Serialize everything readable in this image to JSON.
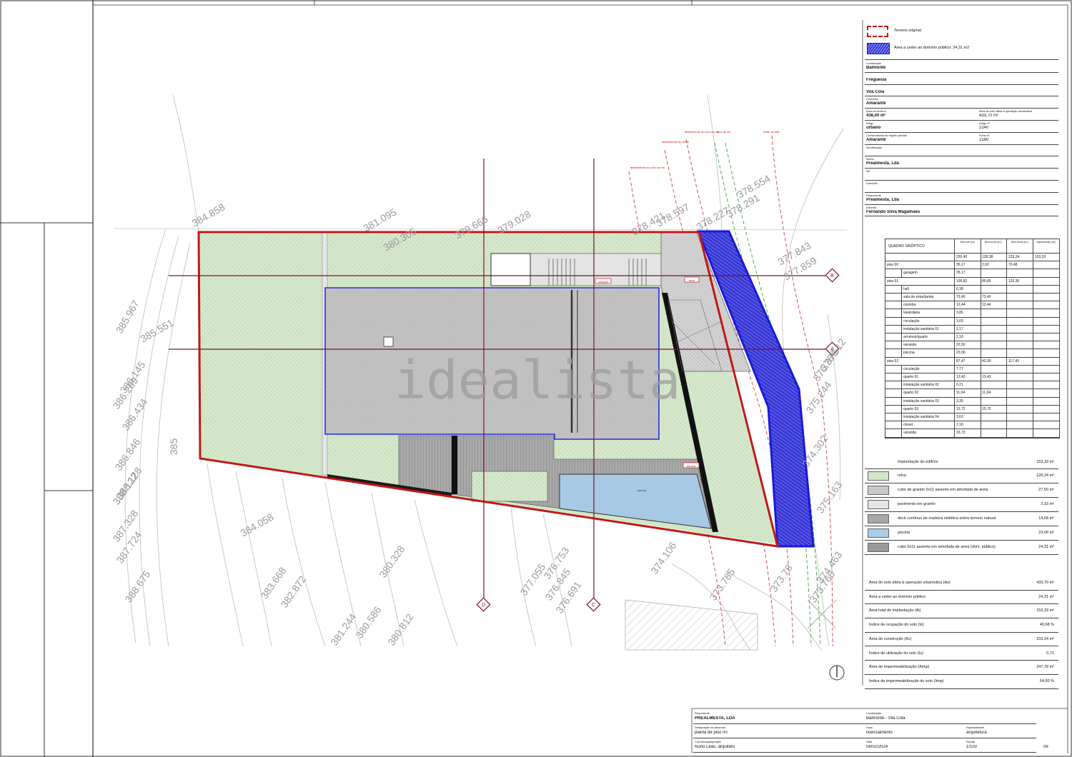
{
  "watermark": "idealista",
  "legend_top": [
    {
      "label": "Terreno original",
      "swatch": "red-dashed"
    },
    {
      "label": "Área a ceder ao domínio público: 24,31 m2",
      "swatch": "blue-hatch"
    }
  ],
  "info": {
    "rows": [
      {
        "h": "Localização",
        "v": "Balmonte"
      },
      {
        "h": "",
        "v": "Freguesia"
      },
      {
        "h": "",
        "v": "Vila Cola"
      },
      {
        "h": "Concelho",
        "v": "Amarante"
      },
      {
        "h": "Área do terreno",
        "v": "438,00 m²",
        "h2": "Área do solo afeta à operação urbanística",
        "v2": "433,70 m²"
      },
      {
        "h": "Artigo",
        "v": "urbano",
        "h2": "Artigo nº",
        "v2": "2140"
      },
      {
        "h": "Conservatória do registo predial",
        "v": "Amarante",
        "h2": "Ficha nº",
        "v2": "2180"
      },
      {
        "h": "Identificação",
        "v": ""
      },
      {
        "h": "Nome",
        "v": "Prealmesta, Lda"
      },
      {
        "h": "Nif",
        "v": ""
      },
      {
        "h": "Domicílio",
        "v": ""
      },
      {
        "h": "Requerente",
        "v": "Prealmesta, Lda"
      },
      {
        "h": "Gerente",
        "v": "Fernando Silva Magalhães"
      }
    ]
  },
  "synoptic": {
    "title": "QUADRO SINÓPTICO",
    "col_headers": [
      "Área útil (m²)",
      "Área bruta (m²)",
      "Área bruta (m²)",
      "Implantação (m²)"
    ],
    "rows": [
      {
        "name": "",
        "indent": false,
        "v": [
          "230,40",
          "128,38",
          "233,24",
          "153,33"
        ]
      },
      {
        "name": "piso 00",
        "indent": false,
        "v": [
          "35,17",
          "2,00",
          "70,48",
          ""
        ]
      },
      {
        "name": "garagem",
        "indent": true,
        "v": [
          "35,17",
          "",
          "",
          ""
        ]
      },
      {
        "name": "piso 01",
        "indent": false,
        "v": [
          "100,82",
          "85,85",
          "133,30",
          ""
        ]
      },
      {
        "name": "hall",
        "indent": true,
        "v": [
          "6,38",
          "",
          "",
          ""
        ]
      },
      {
        "name": "sala de estar/jantar",
        "indent": true,
        "v": [
          "73,40",
          "73,40",
          "",
          ""
        ]
      },
      {
        "name": "cozinha",
        "indent": true,
        "v": [
          "12,44",
          "12,44",
          "",
          ""
        ]
      },
      {
        "name": "lavandaria",
        "indent": true,
        "v": [
          "3,86",
          "",
          "",
          ""
        ]
      },
      {
        "name": "circulação",
        "indent": true,
        "v": [
          "3,03",
          "",
          "",
          ""
        ]
      },
      {
        "name": "instalação sanitária 01",
        "indent": true,
        "v": [
          "2,17",
          "",
          "",
          ""
        ]
      },
      {
        "name": "arrumos/quarto",
        "indent": true,
        "v": [
          "2,18",
          "",
          "",
          ""
        ]
      },
      {
        "name": "varanda",
        "indent": true,
        "v": [
          "22,50",
          "",
          "",
          ""
        ]
      },
      {
        "name": "piscina",
        "indent": true,
        "v": [
          "23,06",
          "",
          "",
          ""
        ]
      },
      {
        "name": "piso 02",
        "indent": false,
        "v": [
          "87,47",
          "42,00",
          "117,43",
          ""
        ]
      },
      {
        "name": "circulação",
        "indent": true,
        "v": [
          "7,77",
          "",
          "",
          ""
        ]
      },
      {
        "name": "quarto 01",
        "indent": true,
        "v": [
          "13,43",
          "13,43",
          "",
          ""
        ]
      },
      {
        "name": "instalação sanitária 02",
        "indent": true,
        "v": [
          "6,21",
          "",
          "",
          ""
        ]
      },
      {
        "name": "quarto 02",
        "indent": true,
        "v": [
          "11,04",
          "11,04",
          "",
          ""
        ]
      },
      {
        "name": "instalação sanitária 03",
        "indent": true,
        "v": [
          "3,30",
          "",
          "",
          ""
        ]
      },
      {
        "name": "quarto 03",
        "indent": true,
        "v": [
          "15,72",
          "15,72",
          "",
          ""
        ]
      },
      {
        "name": "instalação sanitária 04",
        "indent": true,
        "v": [
          "3,63",
          "",
          "",
          ""
        ]
      },
      {
        "name": "closet",
        "indent": true,
        "v": [
          "2,18",
          "",
          "",
          ""
        ]
      },
      {
        "name": "varanda",
        "indent": true,
        "v": [
          "33,73",
          "",
          "",
          ""
        ]
      }
    ]
  },
  "materials": {
    "header": {
      "label": "Implantação do edifício",
      "value": "153,33 m²"
    },
    "items": [
      {
        "label": "relva",
        "value": "128,24 m²",
        "swatch": "#d3e6c9"
      },
      {
        "label": "cubo de granito 5x11 assente em almofada de areia",
        "value": "27,50 m²",
        "swatch": "#c9c9c9"
      },
      {
        "label": "pavimento em granito",
        "value": "2,33 m²",
        "swatch": "#e4e4e4"
      },
      {
        "label": "deck contínuo de madeira sintética sobre terreno natural",
        "value": "14,68 m²",
        "swatch": "#a8a8a8"
      },
      {
        "label": "piscina",
        "value": "23,06 m²",
        "swatch": "#a9cbe6"
      },
      {
        "label": "cubo 5x11 assente em almofada de areia (dom. público)",
        "value": "24,31 m²",
        "swatch": "#9a9a9a"
      }
    ]
  },
  "indices": [
    {
      "label": "Área do solo afeta à operação urbanística (As)",
      "value": "433,70 m²"
    },
    {
      "label": "Área a ceder ao domínio público",
      "value": "24,31 m²"
    },
    {
      "label": "Área total de implantação (Ai)",
      "value": "153,33 m²"
    },
    {
      "label": "Índice de ocupação do solo (Io)",
      "value": "40,68 %"
    },
    {
      "label": "Área de construção (Ac)",
      "value": "233,24 m²"
    },
    {
      "label": "Índice de utilização do solo (Iu)",
      "value": "0,71"
    },
    {
      "label": "Área de impermeabilização (Aimp)",
      "value": "247,78 m²"
    },
    {
      "label": "Índice de impermeabilização do solo (Iimp)",
      "value": "54,60 %"
    }
  ],
  "title_block": {
    "col1": [
      {
        "h": "Requerente",
        "v": "PREALMESTA, LDA"
      },
      {
        "h": "Designação do desenho",
        "v": "planta de piso 00"
      },
      {
        "h": "Coordenação/projeto",
        "v": "Nuno Leão, arquiteto"
      }
    ],
    "col2": [
      {
        "h": "Localização",
        "v": "Balmonte - Vila Cola"
      },
      {
        "h": "Fase",
        "v": "licenciamento"
      },
      {
        "h": "Data",
        "v": "06/02/2024"
      }
    ],
    "col3": [
      {
        "h": "",
        "v": ""
      },
      {
        "h": "Especialidade",
        "v": "arquitetura"
      },
      {
        "h": "Escala",
        "v": "1/100"
      }
    ],
    "sheet": "06"
  },
  "elevations": [
    "384.858",
    "381.095",
    "380.305",
    "379.666",
    "379.028",
    "378.421",
    "378.597",
    "378.227",
    "378.291",
    "378.554",
    "377.843",
    "377.859",
    "385.551",
    "386.289",
    "386.145",
    "386.434",
    "385",
    "386.846",
    "388.122",
    "388.128",
    "387.328",
    "387.724",
    "388.675",
    "384.058",
    "383.668",
    "382.872",
    "380.328",
    "380.812",
    "380.586",
    "381.244",
    "377.055",
    "376.845",
    "376.691",
    "376.753",
    "374.106",
    "373.785",
    "373.78",
    "373.766",
    "374.463",
    "374.302",
    "375.163",
    "375.244",
    "376.376",
    "376.512",
    "385.967"
  ],
  "axis_markers": [
    "B",
    "A",
    "D",
    "C"
  ],
  "drawing_notes": [
    "afastamento ao eixo da via",
    "afastamento ao limite",
    "eixo da via",
    "limite do lote",
    "pérgola",
    "deck",
    "piscina"
  ],
  "colors": {
    "boundary": "#c01818",
    "cession": "#2a2ae0",
    "axis": "#7a1030",
    "lawn": "#d4e7ca",
    "slab": "#bdbdbd",
    "pool": "#a7c9e4"
  }
}
